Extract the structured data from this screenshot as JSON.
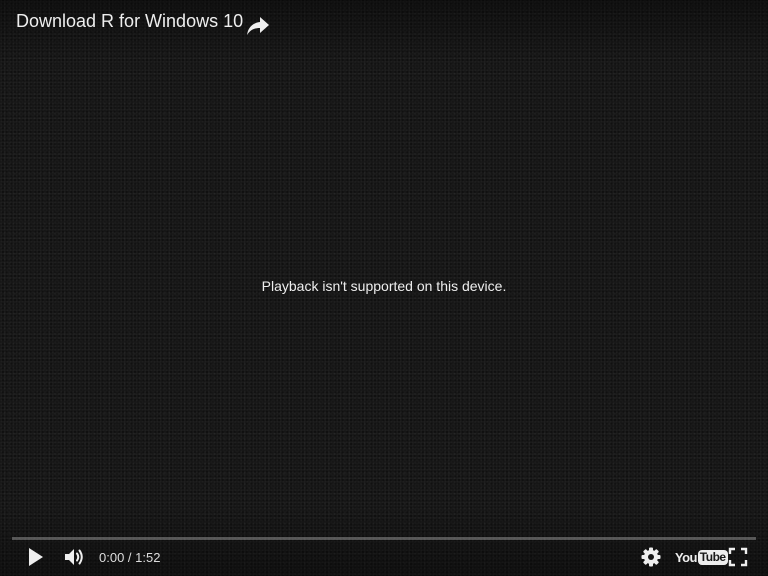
{
  "player": {
    "title": "Download R for Windows 10",
    "message": "Playback isn't supported on this device.",
    "time_current": "0:00",
    "time_separator": " / ",
    "time_total": "1:52",
    "progress_fraction": 0,
    "logo": {
      "you": "You",
      "tube": "Tube"
    },
    "icons": {
      "share": "share-arrow-icon",
      "play": "play-icon",
      "volume": "volume-icon",
      "settings": "gear-icon",
      "fullscreen": "fullscreen-icon"
    },
    "colors": {
      "background": "#151515",
      "text": "#eeeeee",
      "progress_track": "#5a5a5a",
      "progress_played": "#f12b24"
    }
  }
}
